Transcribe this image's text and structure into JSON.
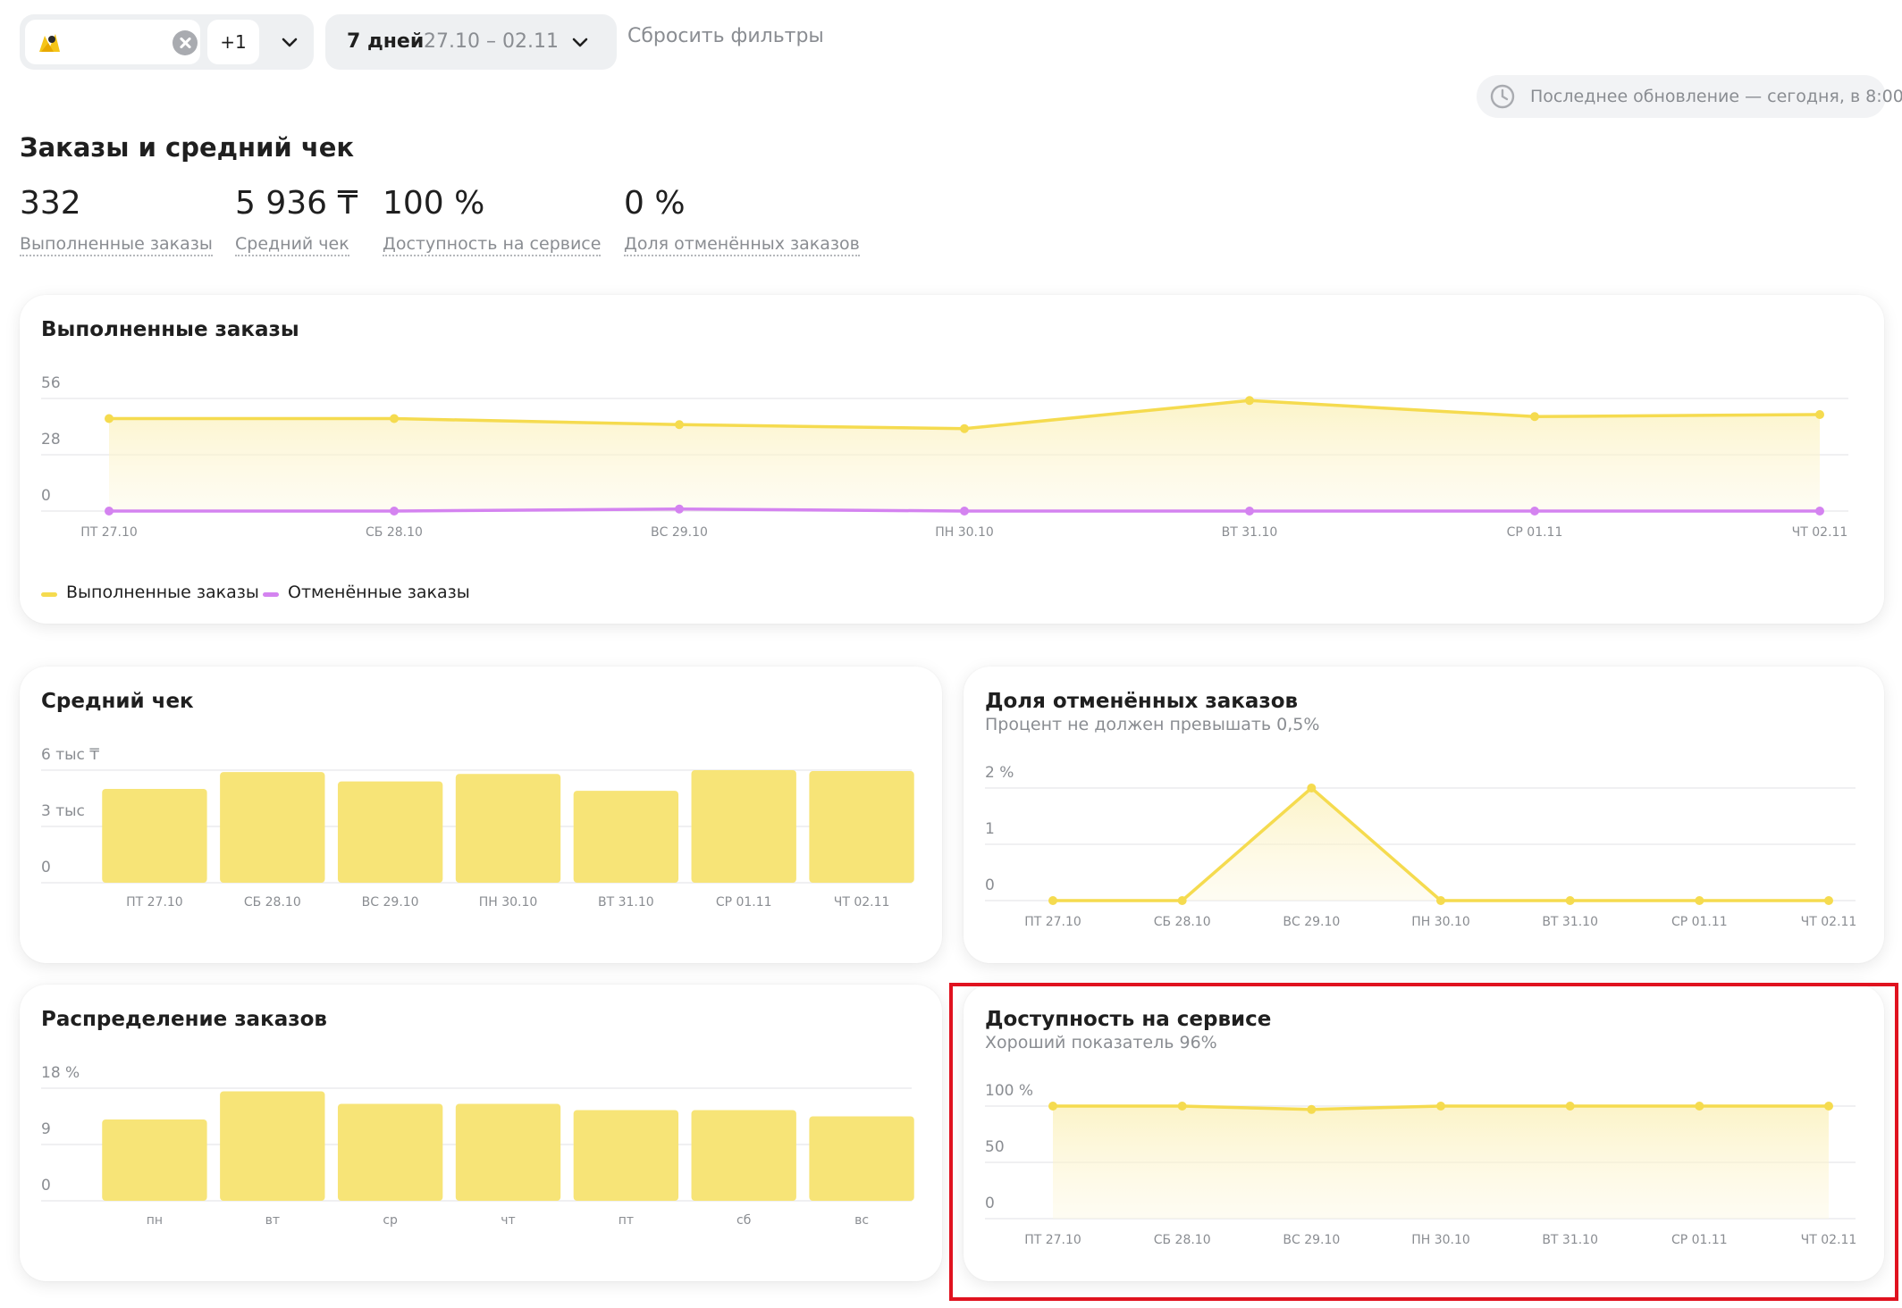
{
  "colors": {
    "yellow": "#f5db4f",
    "yellow_bar": "#f7e477",
    "purple": "#d483f0",
    "grid": "#ececee",
    "muted": "#8a8d92",
    "highlight": "#e0121f"
  },
  "filters": {
    "store_logo_icon": "store-logo-icon",
    "clear_icon": "clear-icon",
    "more_stores": "+1",
    "period_label": "7 дней",
    "period_range": "27.10 – 02.11",
    "reset_label": "Сбросить фильтры"
  },
  "last_update": "Последнее обновление — сегодня, в 8:00",
  "section_title": "Заказы и средний чек",
  "kpis": [
    {
      "value": "332",
      "label": "Выполненные заказы"
    },
    {
      "value": "5 936 ₸",
      "label": "Средний чек"
    },
    {
      "value": "100 %",
      "label": "Доступность на сервисе"
    },
    {
      "value": "0 %",
      "label": "Доля отменённых заказов"
    }
  ],
  "cards": {
    "completed": {
      "title": "Выполненные заказы",
      "legend": [
        "Выполненные заказы",
        "Отменённые заказы"
      ]
    },
    "avg_check": {
      "title": "Средний чек"
    },
    "cancel_share": {
      "title": "Доля отменённых заказов",
      "subtitle": "Процент не должен превышать 0,5%"
    },
    "distribution": {
      "title": "Распределение заказов"
    },
    "availability": {
      "title": "Доступность на сервисе",
      "subtitle": "Хороший показатель 96%"
    }
  },
  "chart_data": [
    {
      "type": "line",
      "title": "Выполненные заказы",
      "x": [
        "ПТ 27.10",
        "СБ 28.10",
        "ВС 29.10",
        "ПН 30.10",
        "ВТ 31.10",
        "СР 01.11",
        "ЧТ 02.11"
      ],
      "series": [
        {
          "name": "Выполненные заказы",
          "values": [
            46,
            46,
            43,
            41,
            55,
            47,
            48
          ]
        },
        {
          "name": "Отменённые заказы",
          "values": [
            0,
            0,
            1,
            0,
            0,
            0,
            0
          ]
        }
      ],
      "ylim": [
        0,
        56
      ],
      "yticks": [
        "0",
        "28",
        "56"
      ],
      "legend": "bottom-left",
      "grid": true
    },
    {
      "type": "bar",
      "title": "Средний чек",
      "categories": [
        "ПТ 27.10",
        "СБ 28.10",
        "ВС 29.10",
        "ПН 30.10",
        "ВТ 31.10",
        "СР 01.11",
        "ЧТ 02.11"
      ],
      "values": [
        5000,
        5900,
        5400,
        5800,
        4900,
        6000,
        5950
      ],
      "ylim": [
        0,
        6000
      ],
      "yticks": [
        "0",
        "3 тыс",
        "6 тыс ₸"
      ],
      "grid": true
    },
    {
      "type": "line",
      "title": "Доля отменённых заказов",
      "x": [
        "ПТ 27.10",
        "СБ 28.10",
        "ВС 29.10",
        "ПН 30.10",
        "ВТ 31.10",
        "СР 01.11",
        "ЧТ 02.11"
      ],
      "series": [
        {
          "values": [
            0,
            0,
            2,
            0,
            0,
            0,
            0
          ]
        }
      ],
      "ylim": [
        0,
        2
      ],
      "yticks": [
        "0",
        "1",
        "2 %"
      ],
      "grid": true
    },
    {
      "type": "bar",
      "title": "Распределение заказов",
      "categories": [
        "пн",
        "вт",
        "ср",
        "чт",
        "пт",
        "сб",
        "вс"
      ],
      "values": [
        13,
        17.5,
        15.5,
        15.5,
        14.5,
        14.5,
        13.5
      ],
      "ylim": [
        0,
        18
      ],
      "yticks": [
        "0",
        "9",
        "18 %"
      ],
      "grid": true
    },
    {
      "type": "line",
      "title": "Доступность на сервисе",
      "x": [
        "ПТ 27.10",
        "СБ 28.10",
        "ВС 29.10",
        "ПН 30.10",
        "ВТ 31.10",
        "СР 01.11",
        "ЧТ 02.11"
      ],
      "series": [
        {
          "values": [
            100,
            100,
            97,
            100,
            100,
            100,
            100
          ]
        }
      ],
      "ylim": [
        0,
        100
      ],
      "yticks": [
        "0",
        "50",
        "100 %"
      ],
      "grid": true
    }
  ]
}
